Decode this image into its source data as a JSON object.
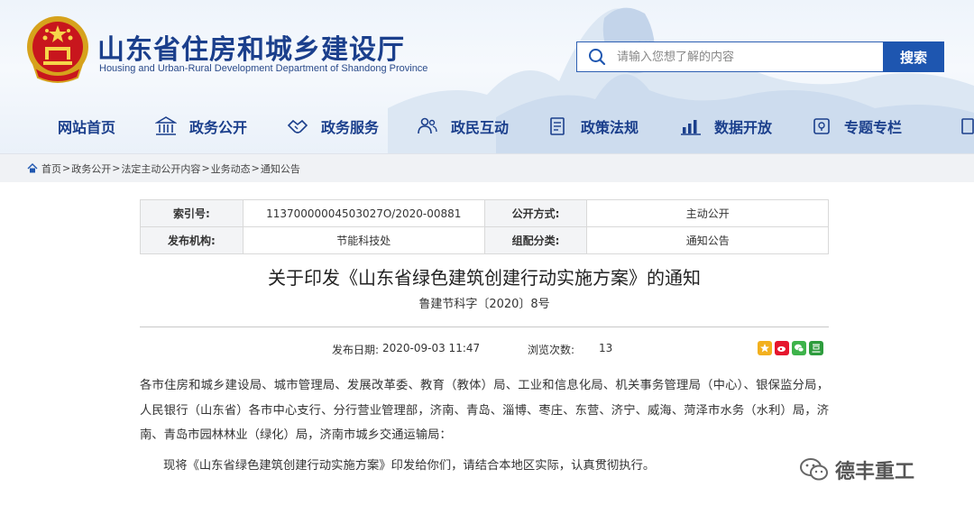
{
  "site": {
    "title": "山东省住房和城乡建设厅",
    "subtitle": "Housing and Urban-Rural Development Department of Shandong Province",
    "brand_color": "#1b3f8c"
  },
  "search": {
    "placeholder": "请输入您想了解的内容",
    "button": "搜索"
  },
  "nav": {
    "items": [
      {
        "label": "网站首页",
        "icon": "none"
      },
      {
        "label": "政务公开",
        "icon": "institution-icon"
      },
      {
        "label": "政务服务",
        "icon": "handshake-icon"
      },
      {
        "label": "政民互动",
        "icon": "people-icon"
      },
      {
        "label": "政策法规",
        "icon": "document-icon"
      },
      {
        "label": "数据开放",
        "icon": "chart-icon"
      },
      {
        "label": "专题专栏",
        "icon": "column-icon"
      }
    ]
  },
  "breadcrumb": {
    "items": [
      "首页",
      "政务公开",
      "法定主动公开内容",
      "业务动态",
      "通知公告"
    ],
    "separator": ">"
  },
  "meta": {
    "index_label": "索引号:",
    "index_value": "11370000004503027O/2020-00881",
    "public_mode_label": "公开方式:",
    "public_mode_value": "主动公开",
    "publisher_label": "发布机构:",
    "publisher_value": "节能科技处",
    "category_label": "组配分类:",
    "category_value": "通知公告"
  },
  "article": {
    "title": "关于印发《山东省绿色建筑创建行动实施方案》的通知",
    "doc_number": "鲁建节科字〔2020〕8号",
    "publish_label": "发布日期:",
    "publish_date": "2020-09-03 11:47",
    "views_label": "浏览次数:",
    "views": "13",
    "recipients": "各市住房和城乡建设局、城市管理局、发展改革委、教育（教体）局、工业和信息化局、机关事务管理局（中心）、银保监分局，人民银行（山东省）各市中心支行、分行营业管理部，济南、青岛、淄博、枣庄、东营、济宁、威海、菏泽市水务（水利）局，济南、青岛市园林林业（绿化）局，济南市城乡交通运输局：",
    "paragraph1": "现将《山东省绿色建筑创建行动实施方案》印发给你们，请结合本地区实际，认真贯彻执行。"
  },
  "watermark": {
    "text": "德丰重工"
  }
}
